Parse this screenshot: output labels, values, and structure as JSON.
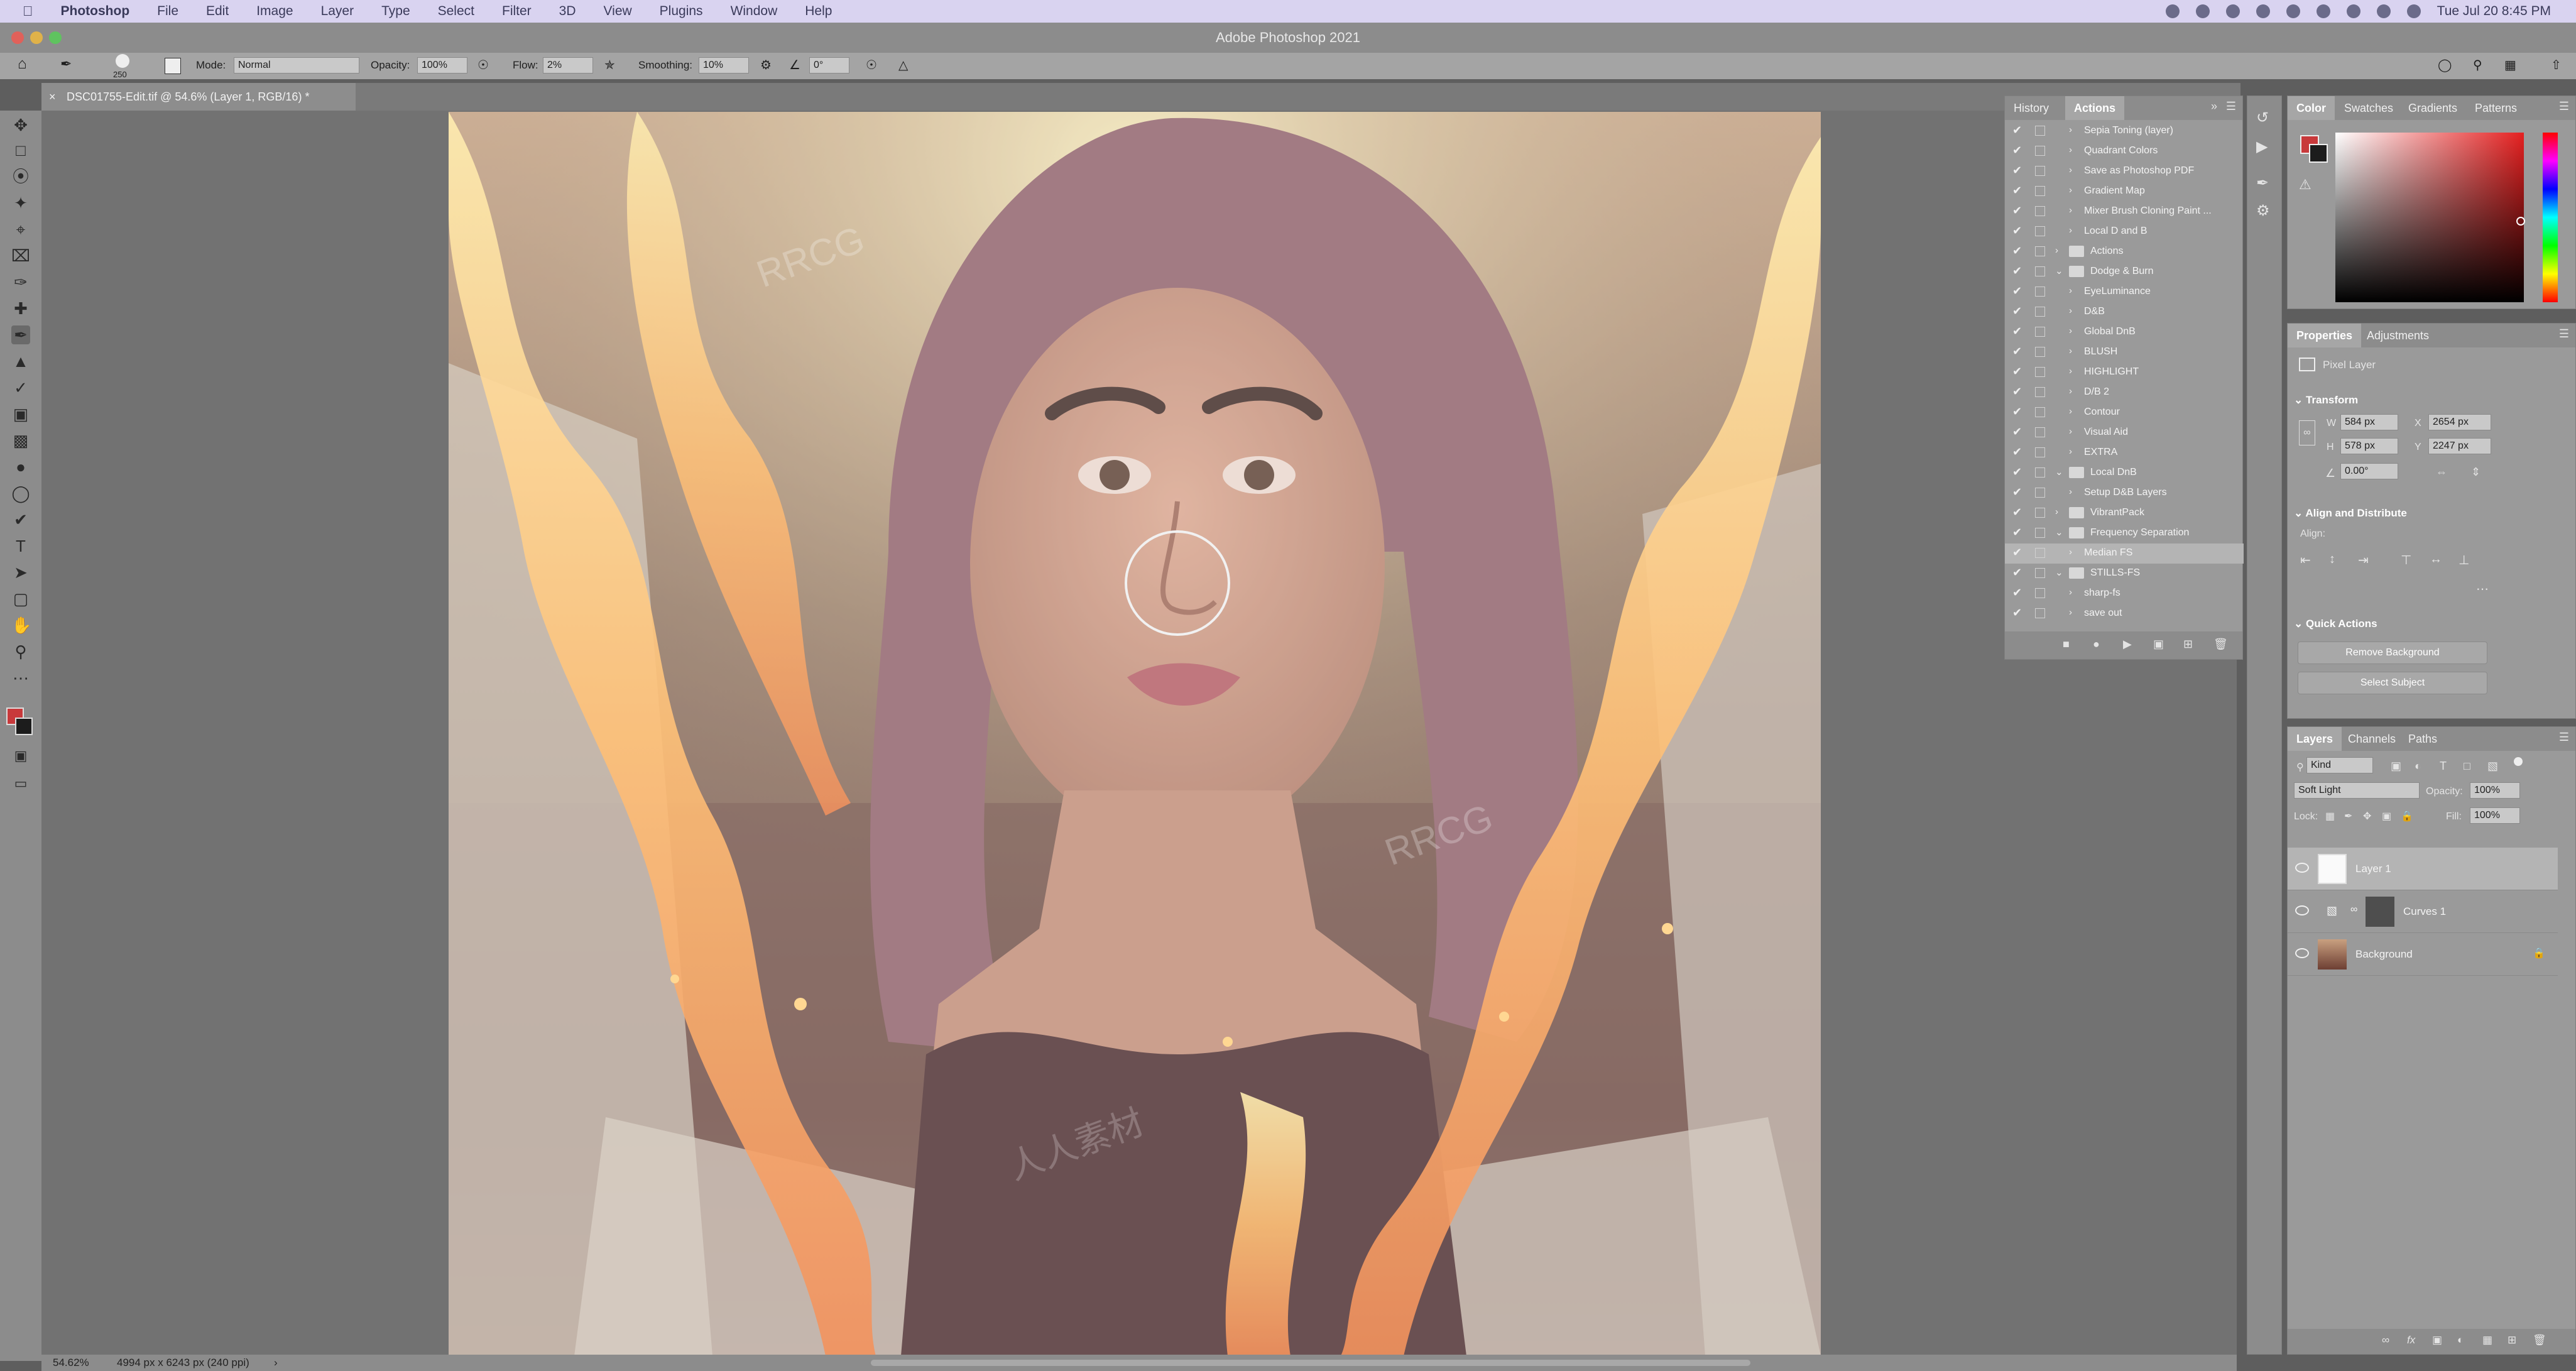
{
  "menubar": {
    "app": "Photoshop",
    "items": [
      "File",
      "Edit",
      "Image",
      "Layer",
      "Type",
      "Select",
      "Filter",
      "3D",
      "View",
      "Plugins",
      "Window",
      "Help"
    ],
    "clock": "Tue Jul 20  8:45 PM"
  },
  "window": {
    "title": "Adobe Photoshop 2021"
  },
  "options": {
    "brush_size": "250",
    "mode_label": "Mode:",
    "mode_value": "Normal",
    "opacity_label": "Opacity:",
    "opacity_value": "100%",
    "flow_label": "Flow:",
    "flow_value": "2%",
    "smoothing_label": "Smoothing:",
    "smoothing_value": "10%",
    "angle_value": "0°"
  },
  "document": {
    "tab_title": "DSC01755-Edit.tif @ 54.6% (Layer 1, RGB/16) *"
  },
  "history_panel": {
    "tabs": [
      "History",
      "Actions"
    ],
    "active_tab": "Actions",
    "actions": [
      {
        "label": "Sepia Toning (layer)",
        "type": "action",
        "indent": 2
      },
      {
        "label": "Quadrant Colors",
        "type": "action",
        "indent": 2
      },
      {
        "label": "Save as Photoshop PDF",
        "type": "action",
        "indent": 2
      },
      {
        "label": "Gradient Map",
        "type": "action",
        "indent": 2
      },
      {
        "label": "Mixer Brush Cloning Paint ...",
        "type": "action",
        "indent": 2
      },
      {
        "label": "Local D and B",
        "type": "action",
        "indent": 2
      },
      {
        "label": "Actions",
        "type": "set",
        "indent": 1
      },
      {
        "label": "Dodge & Burn",
        "type": "set-open",
        "indent": 0
      },
      {
        "label": "EyeLuminance",
        "type": "action",
        "indent": 2
      },
      {
        "label": "D&B",
        "type": "action",
        "indent": 2
      },
      {
        "label": "Global DnB",
        "type": "action",
        "indent": 2
      },
      {
        "label": "BLUSH",
        "type": "action",
        "indent": 2
      },
      {
        "label": "HIGHLIGHT",
        "type": "action",
        "indent": 2
      },
      {
        "label": "D/B 2",
        "type": "action",
        "indent": 2
      },
      {
        "label": "Contour",
        "type": "action",
        "indent": 2
      },
      {
        "label": "Visual Aid",
        "type": "action",
        "indent": 2
      },
      {
        "label": "EXTRA",
        "type": "action",
        "indent": 2
      },
      {
        "label": "Local DnB",
        "type": "set-open",
        "indent": 0
      },
      {
        "label": "Setup D&B Layers",
        "type": "action",
        "indent": 2
      },
      {
        "label": "VibrantPack",
        "type": "set",
        "indent": 1
      },
      {
        "label": "Frequency Separation",
        "type": "set-open",
        "indent": 0
      },
      {
        "label": "Median FS",
        "type": "action",
        "indent": 2,
        "selected": true
      },
      {
        "label": "STILLS-FS",
        "type": "set-open",
        "indent": 0
      },
      {
        "label": "sharp-fs",
        "type": "action",
        "indent": 2
      },
      {
        "label": "save out",
        "type": "action",
        "indent": 2
      }
    ]
  },
  "color_panel": {
    "tabs": [
      "Color",
      "Swatches",
      "Gradients",
      "Patterns"
    ],
    "active_tab": "Color",
    "foreground": "#c8393b",
    "background": "#1c1c1c"
  },
  "properties_panel": {
    "tabs": [
      "Properties",
      "Adjustments"
    ],
    "active_tab": "Properties",
    "layer_kind": "Pixel Layer",
    "transform_label": "Transform",
    "w_label": "W",
    "w_value": "584 px",
    "h_label": "H",
    "h_value": "578 px",
    "x_label": "X",
    "x_value": "2654 px",
    "y_label": "Y",
    "y_value": "2247 px",
    "angle_value": "0.00°",
    "align_label": "Align and Distribute",
    "align_sub": "Align:",
    "quick_actions_label": "Quick Actions",
    "btn_remove_bg": "Remove Background",
    "btn_select_subject": "Select Subject"
  },
  "layers_panel": {
    "tabs": [
      "Layers",
      "Channels",
      "Paths"
    ],
    "active_tab": "Layers",
    "filter_kind": "Kind",
    "blend_mode": "Soft Light",
    "opacity_label": "Opacity:",
    "opacity_value": "100%",
    "lock_label": "Lock:",
    "fill_label": "Fill:",
    "fill_value": "100%",
    "layers": [
      {
        "name": "Layer 1",
        "selected": true
      },
      {
        "name": "Curves 1",
        "selected": false
      },
      {
        "name": "Background",
        "selected": false
      }
    ]
  },
  "status": {
    "zoom": "54.62%",
    "doc_info": "4994 px x 6243 px (240 ppi)"
  },
  "watermark": {
    "text": "RRCG",
    "text2": "人人素材"
  }
}
